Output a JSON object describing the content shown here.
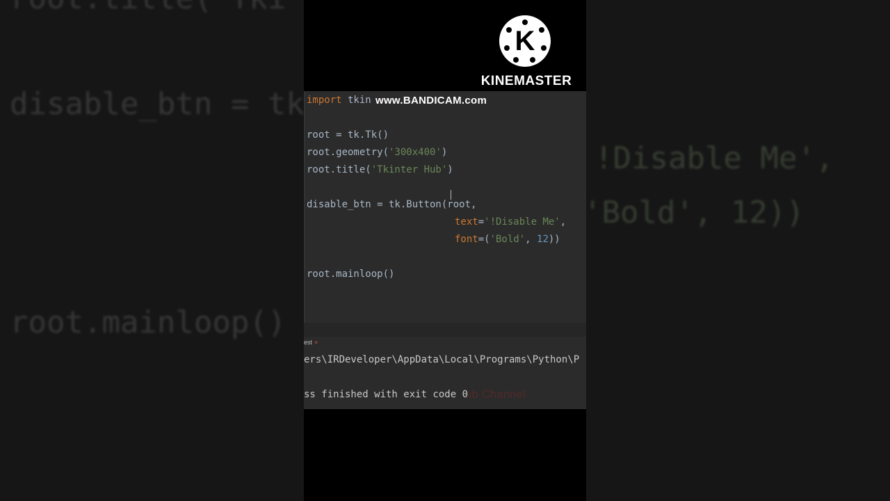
{
  "background_left": {
    "line1": "root.title('Tki",
    "line2": "disable_btn = tk",
    "line3": "root.mainloop()"
  },
  "background_right": {
    "line1": "!Disable Me',",
    "line2": "'Bold', 12))"
  },
  "kinemaster": {
    "logo_letter": "K",
    "brand": "KINEMASTER"
  },
  "watermark": "www.BANDICAM.com",
  "code": {
    "l1_kw": "import",
    "l1_rest": " tkin",
    "l3": "root = tk.Tk()",
    "l4_pre": "root.geometry(",
    "l4_str": "'300x400'",
    "l4_post": ")",
    "l5_pre": "root.title(",
    "l5_str": "'Tkinter Hub'",
    "l5_post": ")",
    "l7": "disable_btn = tk.Button(root,",
    "l8_kw": "text",
    "l8_eq": "=",
    "l8_str": "'!Disable Me'",
    "l8_post": ",",
    "l9_kw": "font",
    "l9_eq": "=(",
    "l9_str": "'Bold'",
    "l9_comma": ", ",
    "l9_num": "12",
    "l9_post": "))",
    "l11": "root.mainloop()"
  },
  "run": {
    "tab_label": "est",
    "tab_close": "×",
    "path": "ers\\IRDeveloper\\AppData\\Local\\Programs\\Python\\P",
    "exit": "ss finished with exit code 0",
    "ghost": "ub Channel"
  },
  "colors": {
    "keyword": "#cc7832",
    "string": "#6a8759",
    "number": "#6897bb",
    "editor_bg": "#2b2b2b"
  }
}
